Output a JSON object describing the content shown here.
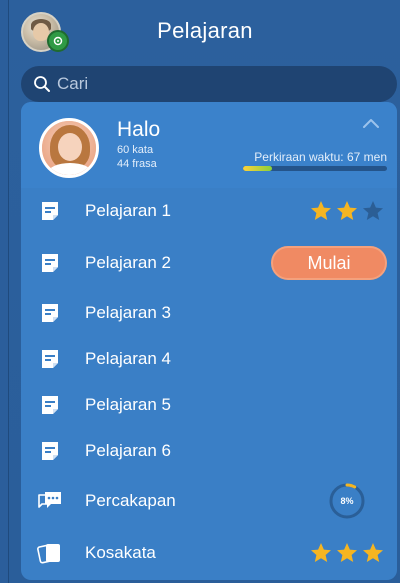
{
  "header": {
    "title": "Pelajaran"
  },
  "search": {
    "placeholder": "Cari"
  },
  "profile": {
    "greeting": "Halo",
    "words": "60 kata",
    "phrases": "44 frasa",
    "estimate": "Perkiraan waktu: 67 men",
    "estimate_progress": 0.2
  },
  "lessons": [
    {
      "label": "Pelajaran 1",
      "stars": 2,
      "max_stars": 3
    },
    {
      "label": "Pelajaran 2",
      "action": "Mulai"
    },
    {
      "label": "Pelajaran 3"
    },
    {
      "label": "Pelajaran 4"
    },
    {
      "label": "Pelajaran 5"
    },
    {
      "label": "Pelajaran 6"
    }
  ],
  "conversation": {
    "label": "Percakapan",
    "progress_text": "8%",
    "progress": 0.08
  },
  "vocabulary": {
    "label": "Kosakata",
    "stars": 3,
    "max_stars": 3
  },
  "colors": {
    "background": "#2c609d",
    "card": "#3a7fc6",
    "accent_button": "#f08a63",
    "star_filled": "#f5b521",
    "star_empty": "#2b5e95"
  },
  "icons": {
    "lesson": "lesson-doc-icon",
    "conversation": "chat-bubbles-icon",
    "vocabulary": "flashcards-icon",
    "search": "search-icon",
    "collapse": "chevron-up-icon"
  }
}
